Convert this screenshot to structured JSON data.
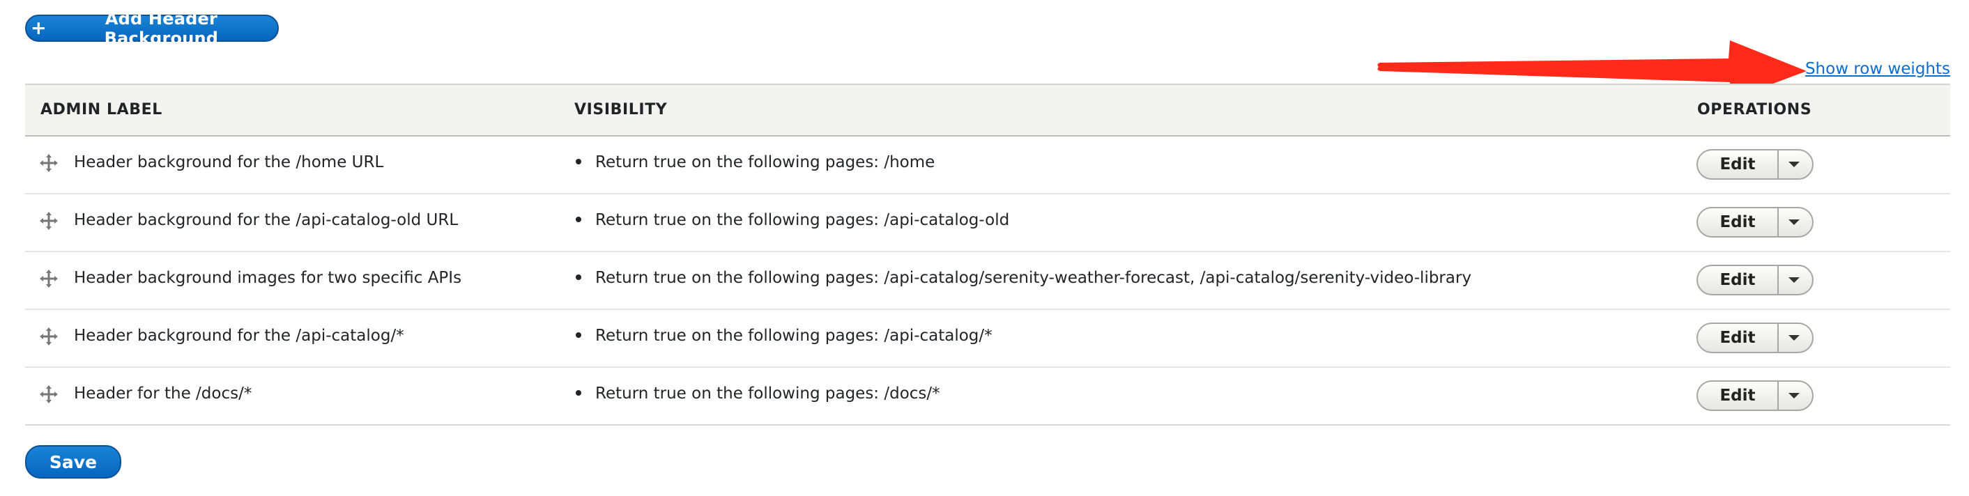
{
  "add_button": {
    "plus": "+",
    "label": "Add Header Background"
  },
  "show_weights_link": "Show row weights",
  "table": {
    "headers": {
      "admin_label": "ADMIN LABEL",
      "visibility": "VISIBILITY",
      "operations": "OPERATIONS"
    },
    "rows": [
      {
        "label": "Header background for the /home URL",
        "visibility": "Return true on the following pages: /home",
        "edit": "Edit"
      },
      {
        "label": "Header background for the /api-catalog-old URL",
        "visibility": "Return true on the following pages: /api-catalog-old",
        "edit": "Edit"
      },
      {
        "label": "Header background images for two specific APIs",
        "visibility": "Return true on the following pages: /api-catalog/serenity-weather-forecast, /api-catalog/serenity-video-library",
        "edit": "Edit"
      },
      {
        "label": "Header background for the /api-catalog/*",
        "visibility": "Return true on the following pages: /api-catalog/*",
        "edit": "Edit"
      },
      {
        "label": "Header for the /docs/*",
        "visibility": "Return true on the following pages: /docs/*",
        "edit": "Edit"
      }
    ]
  },
  "save_button": "Save",
  "colors": {
    "primary": "#0a73c9",
    "link": "#0a6ed1",
    "annotation_arrow": "#ff2a1a",
    "header_bg": "#f3f3ef"
  },
  "icons": {
    "drag_handle": "drag-handle-icon",
    "dropdown": "chevron-down-icon",
    "annotation": "red-arrow-annotation"
  }
}
